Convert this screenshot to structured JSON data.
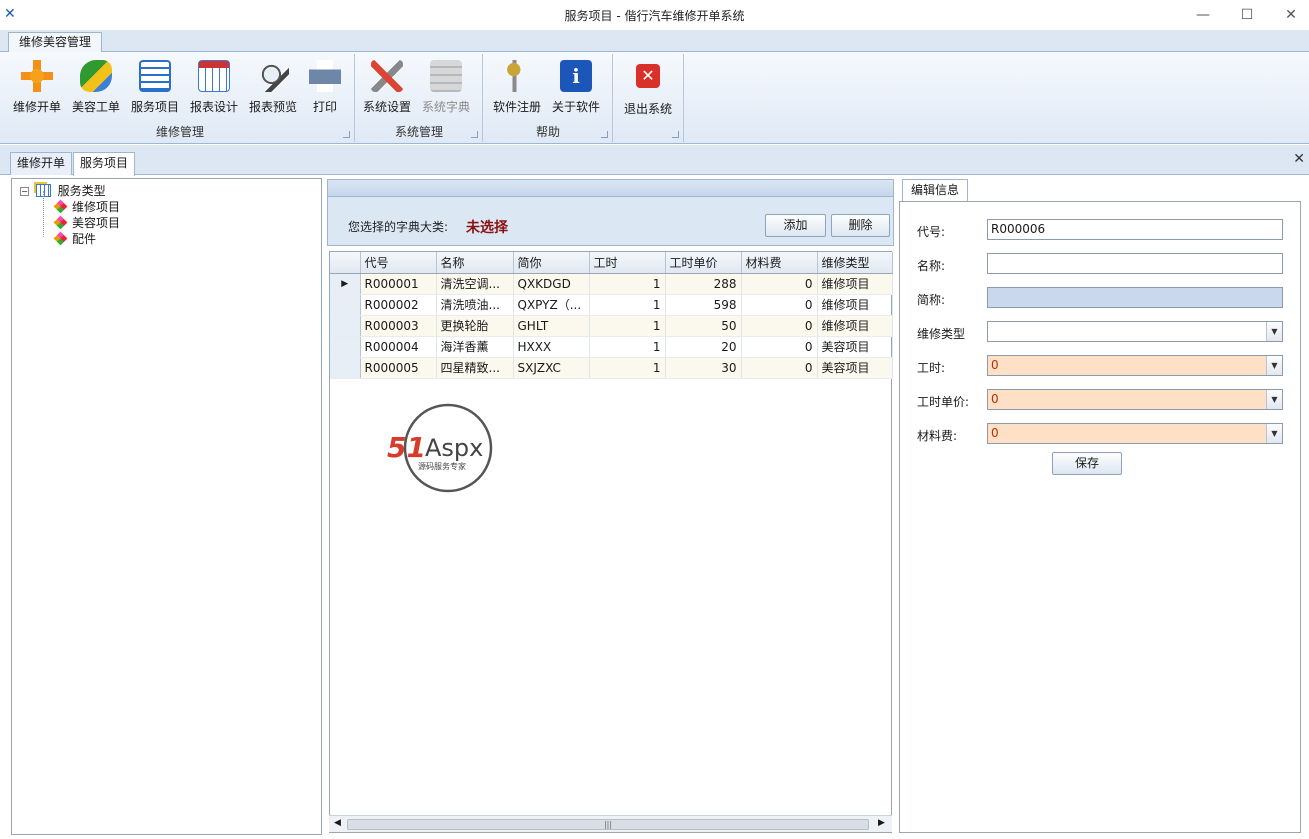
{
  "window": {
    "title": "服务项目 - 偕行汽车维修开单系统",
    "minimize": "—",
    "maximize": "☐",
    "close": "✕"
  },
  "ribbon": {
    "tab": "维修美容管理",
    "groups": [
      {
        "label": "维修管理",
        "buttons": [
          "维修开单",
          "美容工单",
          "服务项目",
          "报表设计",
          "报表预览",
          "打印"
        ]
      },
      {
        "label": "系统管理",
        "buttons": [
          "系统设置",
          "系统字典"
        ]
      },
      {
        "label": "帮助",
        "buttons": [
          "软件注册",
          "关于软件"
        ]
      },
      {
        "label": "",
        "buttons": [
          "退出系统"
        ]
      }
    ]
  },
  "doc_tabs": [
    "维修开单",
    "服务项目"
  ],
  "tree": {
    "root": "服务类型",
    "children": [
      "维修项目",
      "美容项目",
      "配件"
    ]
  },
  "middle": {
    "dict_label": "您选择的字典大类:",
    "dict_value": "未选择",
    "add_button": "添加",
    "delete_button": "删除"
  },
  "grid": {
    "columns": [
      "代号",
      "名称",
      "简你",
      "工时",
      "工时单价",
      "材料费",
      "维修类型"
    ],
    "rows": [
      [
        "R000001",
        "清洗空调...",
        "QXKDGD",
        "1",
        "288",
        "0",
        "维修项目"
      ],
      [
        "R000002",
        "清洗喷油...",
        "QXPYZ（...",
        "1",
        "598",
        "0",
        "维修项目"
      ],
      [
        "R000003",
        "更换轮胎",
        "GHLT",
        "1",
        "50",
        "0",
        "维修项目"
      ],
      [
        "R000004",
        "海洋香薰",
        "HXXX",
        "1",
        "20",
        "0",
        "美容项目"
      ],
      [
        "R000005",
        "四星精致...",
        "SXJZXC",
        "1",
        "30",
        "0",
        "美容项目"
      ]
    ]
  },
  "edit": {
    "tab": "编辑信息",
    "fields": [
      {
        "label": "代号:",
        "value": "R000006"
      },
      {
        "label": "名称:",
        "value": ""
      },
      {
        "label": "简称:",
        "value": ""
      },
      {
        "label": "维修类型",
        "value": ""
      },
      {
        "label": "工时:",
        "value": "0"
      },
      {
        "label": "工时单价:",
        "value": "0"
      },
      {
        "label": "材料费:",
        "value": "0"
      }
    ],
    "save_button": "保存"
  },
  "watermark": {
    "brand": "51Aspx",
    "tagline": "源码服务专家"
  },
  "colors": {
    "accent": "#1e5aa8",
    "dict_value": "#8b1010",
    "ribbon_bg": "#dfe9f5",
    "orange_field": "#fde0c5"
  }
}
